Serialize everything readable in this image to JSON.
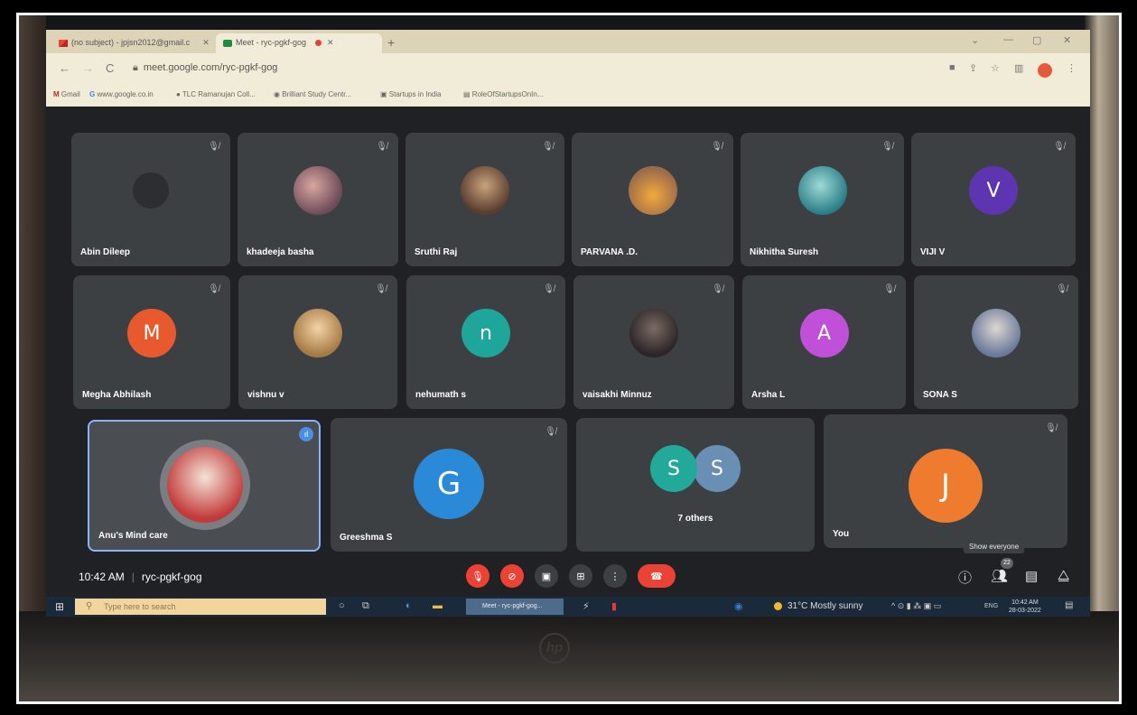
{
  "browser": {
    "tabs": [
      {
        "label": "(no subject) - jpjsn2012@gmail.c",
        "icon": "gmail-icon"
      },
      {
        "label": "Meet - ryc-pgkf-gog",
        "icon": "meet-icon"
      }
    ],
    "url": "meet.google.com/ryc-pgkf-gog",
    "bookmarks": [
      {
        "label": "Gmail"
      },
      {
        "label": "www.google.co.in"
      },
      {
        "label": "TLC Ramanujan Coll..."
      },
      {
        "label": "Brilliant Study Centr..."
      },
      {
        "label": "Startups in India"
      },
      {
        "label": "RoleOfStartupsOnIn..."
      }
    ]
  },
  "meet": {
    "participants_row1": [
      {
        "name": "Abin Dileep",
        "avatar": "",
        "kind": "dark"
      },
      {
        "name": "khadeeja basha",
        "avatar": "",
        "kind": "photo-av"
      },
      {
        "name": "Sruthi Raj",
        "avatar": "",
        "kind": "photo-av2"
      },
      {
        "name": "PARVANA .D.",
        "avatar": "",
        "kind": "photo-av3"
      },
      {
        "name": "Nikhitha Suresh",
        "avatar": "",
        "kind": "photo-av4"
      },
      {
        "name": "VIJI V",
        "avatar": "V",
        "kind": "letter",
        "color": "#5e35b1"
      }
    ],
    "participants_row2": [
      {
        "name": "Megha Abhilash",
        "avatar": "M",
        "kind": "letter",
        "color": "#e8592e"
      },
      {
        "name": "vishnu v",
        "avatar": "",
        "kind": "photo-av5"
      },
      {
        "name": "nehumath s",
        "avatar": "n",
        "kind": "letter",
        "color": "#1fa69a"
      },
      {
        "name": "vaisakhi Minnuz",
        "avatar": "",
        "kind": "photo-av6"
      },
      {
        "name": "Arsha L",
        "avatar": "A",
        "kind": "letter",
        "color": "#c050d8"
      },
      {
        "name": "SONA S",
        "avatar": "",
        "kind": "photo-av7"
      }
    ],
    "row3": {
      "anu": {
        "name": "Anu's Mind care"
      },
      "greeshma": {
        "name": "Greeshma S",
        "avatar": "G",
        "color": "#2a8ad8"
      },
      "others": {
        "label": "7 others",
        "avatar1": "S",
        "avatar2": "S",
        "color1": "#22a99a",
        "color2": "#6a8fb5"
      },
      "you": {
        "name": "You",
        "avatar": "J",
        "color": "#ef7b2e"
      }
    },
    "time": "10:42 AM",
    "separator": "|",
    "meeting_code": "ryc-pgkf-gog",
    "participant_count": "22",
    "tooltip": "Show everyone"
  },
  "taskbar": {
    "search_placeholder": "Type here to search",
    "active_app": "Meet - ryc-pgkf-gog...",
    "weather": "31°C  Mostly sunny",
    "lang": "ENG",
    "clock_time": "10:42 AM",
    "clock_date": "28-03-2022"
  },
  "colors": {
    "meet_bg": "#202124",
    "tile_bg": "#3c4043",
    "end_call": "#ea4335"
  }
}
